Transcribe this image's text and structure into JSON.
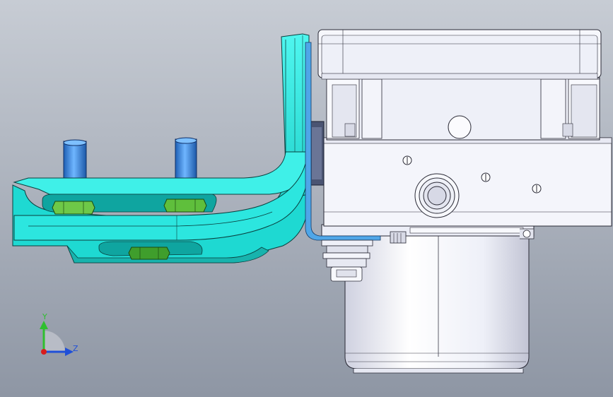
{
  "viewport": {
    "background_top": "#c5cad2",
    "background_bottom": "#8f97a5"
  },
  "model": {
    "bracket_color": "#22e8e0",
    "bracket_shadow": "#12b6b0",
    "bracket_edge": "#0a3f3e",
    "nut_color": "#6ec848",
    "stud_color": "#3b8fe6",
    "housing_color": "#f4f5fb",
    "housing_shadow": "#c9cbd9",
    "edge_color": "#2a2a36",
    "clip_color": "#4fa6e8"
  },
  "triad": {
    "y_label": "Y",
    "z_label": "Z",
    "y_color": "#2fbf2f",
    "z_color": "#1f4fd8",
    "origin_color": "#d81c1c"
  }
}
